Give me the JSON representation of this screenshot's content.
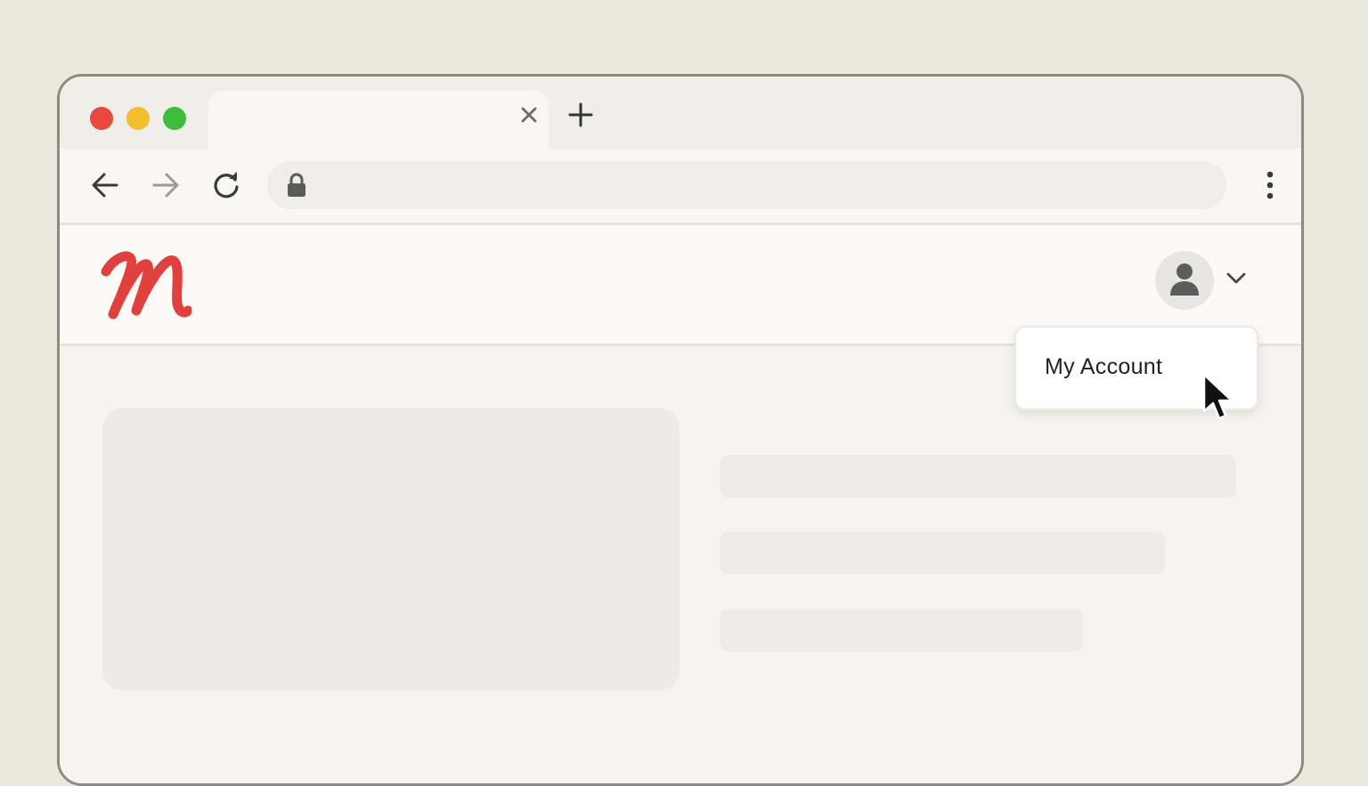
{
  "colors": {
    "traffic_red": "#e9483f",
    "traffic_yellow": "#f3bd2d",
    "traffic_green": "#3cbc3c",
    "logo_red": "#e0413f"
  },
  "tab": {
    "title": "",
    "close_icon": "close-icon",
    "new_tab_icon": "plus-icon"
  },
  "toolbar": {
    "back_icon": "arrow-left-icon",
    "forward_icon": "arrow-right-icon",
    "reload_icon": "reload-icon",
    "address": "",
    "lock_icon": "lock-icon",
    "menu_icon": "kebab-menu-icon"
  },
  "header": {
    "logo_icon": "script-m-logo",
    "avatar_icon": "user-icon",
    "dropdown_icon": "chevron-down-icon"
  },
  "account_menu": {
    "items": [
      {
        "label": "My Account"
      }
    ]
  },
  "pointer": "arrow-cursor-icon"
}
